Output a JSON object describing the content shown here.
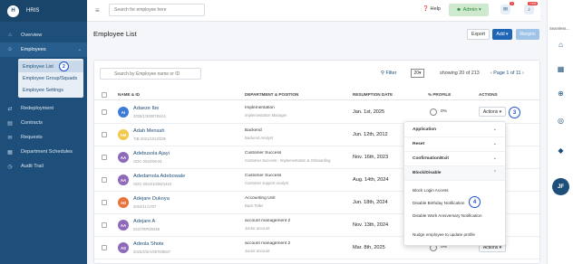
{
  "app": {
    "logo_text": "H",
    "name": "HRIS"
  },
  "sidebar": {
    "items": [
      {
        "label": "Overview"
      },
      {
        "label": "Employees"
      },
      {
        "label": "Redeployment"
      },
      {
        "label": "Contracts"
      },
      {
        "label": "Requests"
      },
      {
        "label": "Department Schedules"
      },
      {
        "label": "Audit Trail"
      }
    ],
    "submenu": [
      {
        "label": "Employee List"
      },
      {
        "label": "Employee Group/Squads"
      },
      {
        "label": "Employee Settings"
      }
    ]
  },
  "topbar": {
    "search_placeholder": "Search for employee here",
    "help_label": "Help",
    "admin_label": "Admin",
    "chat_badge": "2",
    "notif_badge": "1968"
  },
  "rightbar": {
    "label": "Seamless...",
    "avatar": "JF"
  },
  "page": {
    "title": "Employee List"
  },
  "toolbar": {
    "export_label": "Export",
    "add_label": "Add",
    "resync_label": "Resync"
  },
  "list": {
    "search_placeholder": "Search by Employee name or ID",
    "filter_label": "Filter",
    "page_size": "20",
    "showing": "showing 20 of 213",
    "pager": "Page 1 of 11"
  },
  "table": {
    "headers": {
      "name": "NAME & ID",
      "dept": "DEPARTMENT & POSITION",
      "date": "RESUMPTION DATE",
      "profile": "% PROFILE",
      "actions": "ACTIONS"
    },
    "rows": [
      {
        "initials": "AI",
        "color": "#3d7bd6",
        "name": "Adaeze Ibe",
        "id": "2025/1/300078/441",
        "dept": "Implementation",
        "position": "Implementation Manager",
        "date": "Jan. 1st, 2025",
        "profile": "0%",
        "action": "Actions"
      },
      {
        "initials": "AM",
        "color": "#f2c94c",
        "name": "Adah Mensah",
        "id": "TIB-2021/1013/235",
        "dept": "Backend",
        "position": "Backend Analyst",
        "date": "Jun. 12th, 2012",
        "profile": "",
        "action": ""
      },
      {
        "initials": "AA",
        "color": "#8e6ab8",
        "name": "Adebusola Ajayi",
        "id": "GDC-2022/06-81",
        "dept": "Customer Success",
        "position": "Customer Success - Implementation & Onboarding",
        "date": "Nov. 16th, 2023",
        "profile": "",
        "action": ""
      },
      {
        "initials": "AA",
        "color": "#8e6ab8",
        "name": "Adedamola Adebowale",
        "id": "GDC-2024/10/06/1410",
        "dept": "Customer Success",
        "position": "Customer support Analyst",
        "date": "Aug. 14th, 2024",
        "profile": "",
        "action": ""
      },
      {
        "initials": "AD",
        "color": "#e8743b",
        "name": "Adejare Dukoya",
        "id": "2024/11/1707",
        "dept": "Accounting Unit",
        "position": "Back Teller",
        "date": "Jun. 18th, 2024",
        "profile": "",
        "action": ""
      },
      {
        "initials": "AA",
        "color": "#8e6ab8",
        "name": "Adejare A",
        "id": "0237/RP0/0455",
        "dept": "account management 2",
        "position": "Junior account",
        "date": "Nov. 13th, 2024",
        "profile": "",
        "action": ""
      },
      {
        "initials": "AS",
        "color": "#8e6ab8",
        "name": "Adeola Shote",
        "id": "2025/2/3/A/0576/8847",
        "dept": "account management 2",
        "position": "Junior account",
        "date": "Mar. 8th, 2025",
        "profile": "0%",
        "action": "Actions"
      }
    ]
  },
  "dropdown": {
    "sections": [
      {
        "label": "Application"
      },
      {
        "label": "Reset"
      },
      {
        "label": "Confirmation/Exit"
      },
      {
        "label": "Block/Disable"
      }
    ],
    "items": [
      {
        "label": "Block Login Access"
      },
      {
        "label": "Disable Birthday Notification"
      },
      {
        "label": "Disable Work Anniversary Notification"
      },
      {
        "label": "Nudge employee to update profile"
      }
    ]
  },
  "callouts": [
    "2",
    "3",
    "4"
  ]
}
